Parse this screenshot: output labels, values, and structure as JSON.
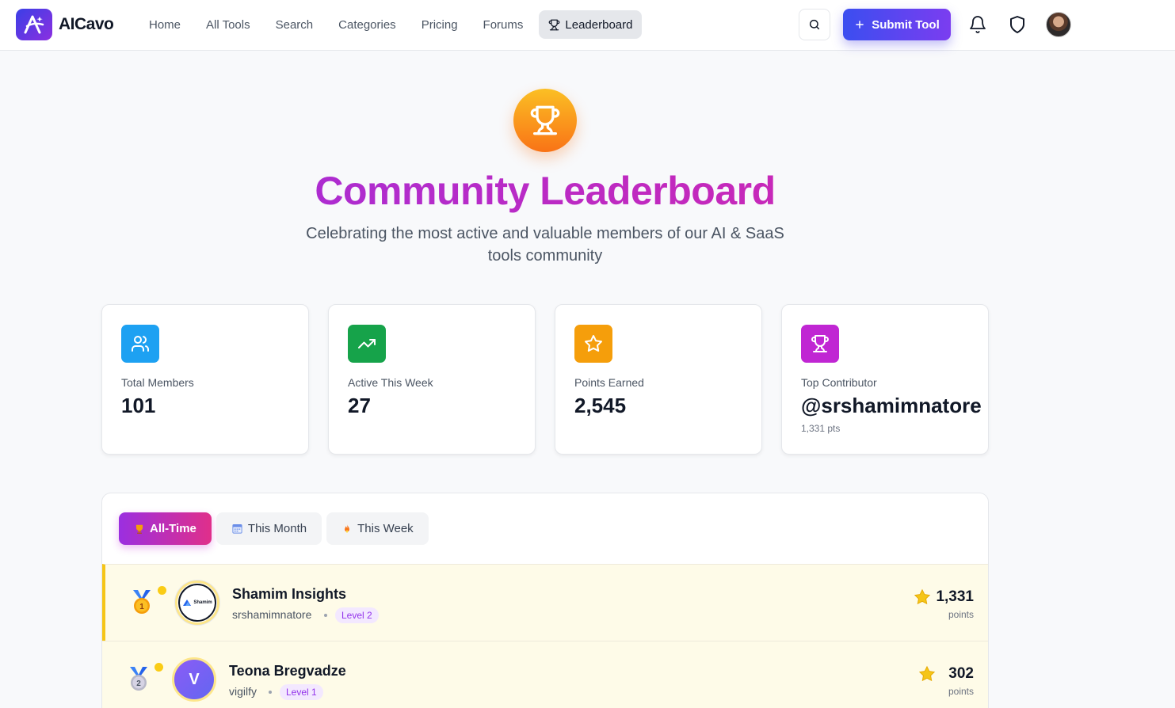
{
  "brand": {
    "name": "AICavo"
  },
  "nav": {
    "items": [
      {
        "label": "Home"
      },
      {
        "label": "All Tools"
      },
      {
        "label": "Search"
      },
      {
        "label": "Categories"
      },
      {
        "label": "Pricing"
      },
      {
        "label": "Forums"
      },
      {
        "label": "Leaderboard",
        "active": true
      }
    ],
    "submit_label": "Submit Tool"
  },
  "hero": {
    "title": "Community Leaderboard",
    "subtitle": "Celebrating the most active and valuable members of our AI & SaaS tools community"
  },
  "stats": [
    {
      "label": "Total Members",
      "value": "101",
      "color": "#1da1f2",
      "icon": "users-icon"
    },
    {
      "label": "Active This Week",
      "value": "27",
      "color": "#16a34a",
      "icon": "trending-up-icon"
    },
    {
      "label": "Points Earned",
      "value": "2,545",
      "color": "#f59e0b",
      "icon": "star-icon"
    },
    {
      "label": "Top Contributor",
      "value": "@srshamimnatore",
      "sub": "1,331 pts",
      "color": "#c026d3",
      "icon": "trophy-icon"
    }
  ],
  "tabs": [
    {
      "label": "All-Time",
      "icon": "trophy-icon",
      "active": true
    },
    {
      "label": "This Month",
      "icon": "calendar-icon"
    },
    {
      "label": "This Week",
      "icon": "flame-icon"
    }
  ],
  "leaderboard": [
    {
      "rank": "1",
      "name": "Shamim Insights",
      "handle": "srshamimnatore",
      "level": "Level 2",
      "points": "1,331",
      "points_label": "points",
      "avatar_logo_text": "Shamim"
    },
    {
      "rank": "2",
      "name": "Teona Bregvadze",
      "handle": "vigilfy",
      "level": "Level 1",
      "points": "302",
      "points_label": "points",
      "avatar_initial": "V"
    }
  ]
}
